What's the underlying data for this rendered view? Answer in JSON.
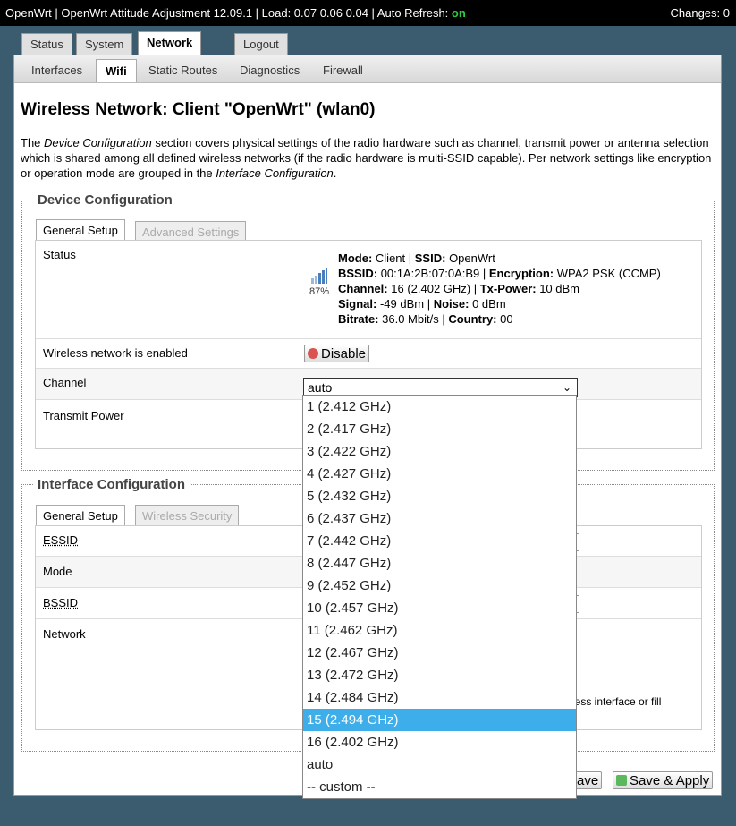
{
  "topbar": {
    "info_prefix": "OpenWrt | OpenWrt Attitude Adjustment 12.09.1 | Load: 0.07 0.06 0.04 | Auto Refresh: ",
    "auto_refresh_value": "on",
    "changes": "Changes: 0"
  },
  "main_tabs": [
    {
      "label": "Status"
    },
    {
      "label": "System"
    },
    {
      "label": "Network"
    },
    {
      "label": "Logout"
    }
  ],
  "sub_tabs": [
    {
      "label": "Interfaces"
    },
    {
      "label": "Wifi"
    },
    {
      "label": "Static Routes"
    },
    {
      "label": "Diagnostics"
    },
    {
      "label": "Firewall"
    }
  ],
  "page_title": "Wireless Network: Client \"OpenWrt\" (wlan0)",
  "description": {
    "p1": "The ",
    "em1": "Device Configuration",
    "p2": " section covers physical settings of the radio hardware such as channel, transmit power or antenna selection which is shared among all defined wireless networks (if the radio hardware is multi-SSID capable). Per network settings like encryption or operation mode are grouped in the ",
    "em2": "Interface Configuration",
    "p3": "."
  },
  "device_config": {
    "legend": "Device Configuration",
    "tabs": [
      {
        "label": "General Setup"
      },
      {
        "label": "Advanced Settings"
      }
    ],
    "status_label": "Status",
    "signal_percent": "87%",
    "status": {
      "mode_label": "Mode:",
      "mode": "Client",
      "ssid_label": "SSID:",
      "ssid": "OpenWrt",
      "bssid_label": "BSSID:",
      "bssid": "00:1A:2B:07:0A:B9",
      "enc_label": "Encryption:",
      "enc": "WPA2 PSK (CCMP)",
      "channel_label": "Channel:",
      "channel": "16 (2.402 GHz)",
      "txpower_label": "Tx-Power:",
      "txpower": "10 dBm",
      "signal_label": "Signal:",
      "signal": "-49 dBm",
      "noise_label": "Noise:",
      "noise": "0 dBm",
      "bitrate_label": "Bitrate:",
      "bitrate": "36.0 Mbit/s",
      "country_label": "Country:",
      "country": "00"
    },
    "enabled_label": "Wireless network is enabled",
    "disable_button": "Disable",
    "channel_label": "Channel",
    "channel_value": "auto",
    "txpower_label": "Transmit Power"
  },
  "channel_options": [
    "1 (2.412 GHz)",
    "2 (2.417 GHz)",
    "3 (2.422 GHz)",
    "4 (2.427 GHz)",
    "5 (2.432 GHz)",
    "6 (2.437 GHz)",
    "7 (2.442 GHz)",
    "8 (2.447 GHz)",
    "9 (2.452 GHz)",
    "10 (2.457 GHz)",
    "11 (2.462 GHz)",
    "12 (2.467 GHz)",
    "13 (2.472 GHz)",
    "14 (2.484 GHz)",
    "15 (2.494 GHz)",
    "16 (2.402 GHz)",
    "auto",
    "-- custom --"
  ],
  "highlighted_option": "15 (2.494 GHz)",
  "interface_config": {
    "legend": "Interface Configuration",
    "tabs": [
      {
        "label": "General Setup"
      },
      {
        "label": "Wireless Security"
      }
    ],
    "essid_label": "ESSID",
    "mode_label": "Mode",
    "bssid_label": "BSSID",
    "network_label": "Network",
    "network_help_tail": "less interface or fill"
  },
  "footer": {
    "save_label": "Save",
    "save_apply_label": "Save & Apply"
  },
  "colors": {
    "page_bg": "#3b5b6f",
    "accent_on": "#2ecc40",
    "highlight": "#3daee9"
  }
}
